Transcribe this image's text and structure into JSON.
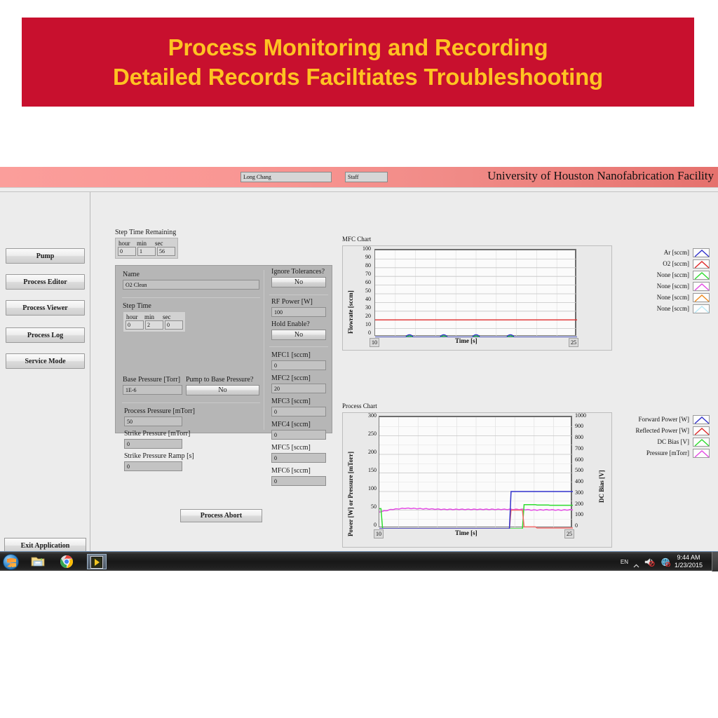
{
  "banner": {
    "line1": "Process Monitoring and Recording",
    "line2": "Detailed Records Faciltiates Troubleshooting",
    "bg_color": "#c8102e",
    "text_color": "#ffc322"
  },
  "app_header": {
    "user_name": "Long Chang",
    "user_role": "Staff",
    "facility_title": "University of Houston Nanofabrication Facility"
  },
  "sidebar": {
    "items": [
      {
        "label": "Pump"
      },
      {
        "label": "Process Editor"
      },
      {
        "label": "Process Viewer"
      },
      {
        "label": "Process Log"
      },
      {
        "label": "Service Mode"
      }
    ],
    "exit_label": "Exit Application"
  },
  "step_time_remaining": {
    "caption": "Step Time Remaining",
    "headers": [
      "hour",
      "min",
      "sec"
    ],
    "values": [
      "0",
      "1",
      "56"
    ]
  },
  "recipe": {
    "name_label": "Name",
    "name_value": "O2 Clean",
    "step_time_label": "Step Time",
    "step_time_headers": [
      "hour",
      "min",
      "sec"
    ],
    "step_time_values": [
      "0",
      "2",
      "0"
    ],
    "base_pressure_label": "Base Pressure [Torr]",
    "base_pressure_value": "1E-6",
    "pump_to_base_label": "Pump to Base Pressure?",
    "pump_to_base_value": "No",
    "process_pressure_label": "Process Pressure [mTorr]",
    "process_pressure_value": "50",
    "strike_pressure_label": "Strike Pressure [mTorr]",
    "strike_pressure_value": "0",
    "strike_ramp_label": "Strike Pressure Ramp [s]",
    "strike_ramp_value": "0",
    "ignore_tolerances_label": "Ignore Tolerances?",
    "ignore_tolerances_value": "No",
    "rf_power_label": "RF Power [W]",
    "rf_power_value": "100",
    "hold_enable_label": "Hold Enable?",
    "hold_enable_value": "No",
    "mfc": [
      {
        "label": "MFC1 [sccm]",
        "value": "0"
      },
      {
        "label": "MFC2 [sccm]",
        "value": "20"
      },
      {
        "label": "MFC3 [sccm]",
        "value": "0"
      },
      {
        "label": "MFC4 [sccm]",
        "value": "0"
      },
      {
        "label": "MFC5 [sccm]",
        "value": "0"
      },
      {
        "label": "MFC6 [sccm]",
        "value": "0"
      }
    ],
    "abort_label": "Process Abort"
  },
  "chart_data": [
    {
      "type": "line",
      "title": "MFC Chart",
      "xlabel": "Time [s]",
      "ylabel": "Flowrate [sccm]",
      "xlim": [
        10,
        25
      ],
      "ylim": [
        0,
        100
      ],
      "xticks": [
        "10",
        "25"
      ],
      "yticks": [
        "0",
        "10",
        "20",
        "30",
        "40",
        "50",
        "60",
        "70",
        "80",
        "90",
        "100"
      ],
      "grid": true,
      "legend_position": "right",
      "series": [
        {
          "name": "Ar [sccm]",
          "color": "#3333cc",
          "values": [
            0,
            0,
            0,
            0,
            0,
            0,
            0,
            0,
            0,
            0,
            0,
            0,
            0,
            0,
            0,
            0
          ]
        },
        {
          "name": "O2 [sccm]",
          "color": "#e02b2b",
          "values": [
            20,
            20,
            20,
            20,
            20,
            20,
            20,
            20,
            20,
            20,
            20,
            20,
            20,
            20,
            20,
            20
          ]
        },
        {
          "name": "None [sccm]",
          "color": "#2fdc2f",
          "values": [
            0,
            0,
            0,
            0,
            0,
            0,
            0,
            0,
            0,
            0,
            0,
            0,
            0,
            0,
            0,
            0
          ]
        },
        {
          "name": "None [sccm]",
          "color": "#e44be4",
          "values": [
            0,
            0,
            0,
            0,
            0,
            0,
            0,
            0,
            0,
            0,
            0,
            0,
            0,
            0,
            0,
            0
          ]
        },
        {
          "name": "None [sccm]",
          "color": "#f08a1e",
          "values": [
            0,
            0,
            0,
            0,
            0,
            0,
            0,
            0,
            0,
            0,
            0,
            0,
            0,
            0,
            0,
            0
          ]
        },
        {
          "name": "None [sccm]",
          "color": "#b8e8f5",
          "values": [
            0,
            0,
            0,
            0,
            0,
            0,
            0,
            0,
            0,
            0,
            0,
            0,
            0,
            0,
            0,
            0
          ]
        }
      ]
    },
    {
      "type": "line",
      "title": "Process Chart",
      "xlabel": "Time [s]",
      "ylabel": "Power [W] or Pressure [mTorr]",
      "y2label": "DC Bias [V]",
      "xlim": [
        10,
        25
      ],
      "ylim": [
        0,
        300
      ],
      "y2lim": [
        0,
        1000
      ],
      "xticks": [
        "10",
        "25"
      ],
      "yticks": [
        "0",
        "50",
        "100",
        "150",
        "200",
        "250",
        "300"
      ],
      "y2ticks": [
        "0",
        "100",
        "200",
        "300",
        "400",
        "500",
        "600",
        "700",
        "800",
        "900",
        "1000"
      ],
      "grid": true,
      "legend_position": "right",
      "series": [
        {
          "name": "Forward Power [W]",
          "color": "#3333cc",
          "axis": "left",
          "values": [
            0,
            0,
            0,
            0,
            0,
            0,
            0,
            0,
            0,
            0,
            0,
            100,
            100,
            100,
            100,
            100
          ]
        },
        {
          "name": "Reflected Power [W]",
          "color": "#f26a6a",
          "axis": "left",
          "values": [
            0,
            0,
            0,
            0,
            0,
            0,
            0,
            0,
            0,
            0,
            0,
            50,
            5,
            2,
            2,
            2
          ]
        },
        {
          "name": "DC Bias [V]",
          "color": "#2fdc2f",
          "axis": "right",
          "values": [
            180,
            0,
            0,
            0,
            0,
            0,
            0,
            0,
            0,
            0,
            0,
            0,
            215,
            212,
            210,
            210
          ]
        },
        {
          "name": "Pressure [mTorr]",
          "color": "#e44be4",
          "axis": "left",
          "values": [
            45,
            52,
            55,
            54,
            53,
            52,
            52,
            52,
            52,
            52,
            52,
            52,
            50,
            51,
            50,
            51
          ]
        }
      ]
    }
  ],
  "taskbar": {
    "icons": [
      "start-orb",
      "explorer-icon",
      "chrome-icon",
      "labview-icon"
    ],
    "tray_lang": "EN",
    "tray_time": "9:44 AM",
    "tray_date": "1/23/2015"
  }
}
